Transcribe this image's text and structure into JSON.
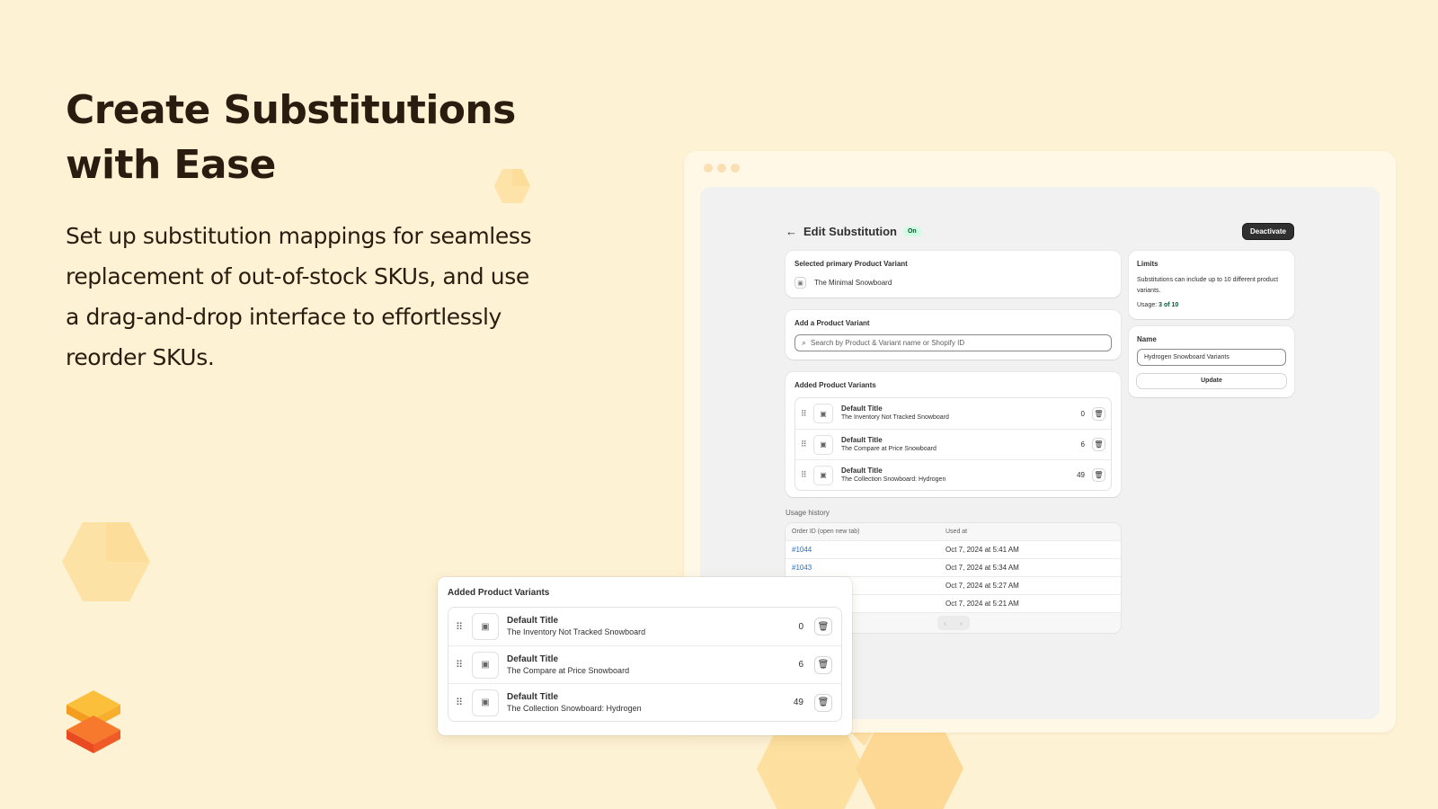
{
  "hero": {
    "title_line1": "Create Substitutions",
    "title_line2": "with Ease",
    "subtitle": "Set up substitution mappings for seamless replacement of out-of-stock SKUs, and use a drag-and-drop interface to effortlessly reorder SKUs."
  },
  "colors": {
    "background": "#fef2d4",
    "hex": "#fde3a8",
    "logo_orange": "#f7a829",
    "logo_red": "#ef4b23"
  },
  "app": {
    "back_icon": "arrow-left-icon",
    "title": "Edit Substitution",
    "status_badge": "On",
    "deactivate_label": "Deactivate",
    "primary_card": {
      "title": "Selected primary Product Variant",
      "variant_name": "The Minimal Snowboard"
    },
    "add_card": {
      "title": "Add a Product Variant",
      "search_placeholder": "Search by Product & Variant name or Shopify ID"
    },
    "variants_card": {
      "title": "Added Product Variants",
      "items": [
        {
          "title": "Default Title",
          "product": "The Inventory Not Tracked Snowboard",
          "qty": "0"
        },
        {
          "title": "Default Title",
          "product": "The Compare at Price Snowboard",
          "qty": "6"
        },
        {
          "title": "Default Title",
          "product": "The Collection Snowboard: Hydrogen",
          "qty": "49"
        }
      ]
    },
    "usage_history": {
      "label": "Usage history",
      "col_order": "Order ID (open new tab)",
      "col_used": "Used at",
      "rows": [
        {
          "order": "#1044",
          "used_at": "Oct 7, 2024 at 5:41 AM"
        },
        {
          "order": "#1043",
          "used_at": "Oct 7, 2024 at 5:34 AM"
        },
        {
          "order": "",
          "used_at": "Oct 7, 2024 at 5:27 AM"
        },
        {
          "order": "",
          "used_at": "Oct 7, 2024 at 5:21 AM"
        }
      ],
      "prev": "‹",
      "next": "›"
    },
    "limits": {
      "title": "Limits",
      "description": "Substitutions can include up to 10 different product variants.",
      "usage_label": "Usage:",
      "usage_value": "3 of 10"
    },
    "name_card": {
      "title": "Name",
      "value": "Hydrogen Snowboard Variants",
      "update_label": "Update"
    }
  },
  "zoom": {
    "title": "Added Product Variants",
    "items": [
      {
        "title": "Default Title",
        "product": "The Inventory Not Tracked Snowboard",
        "qty": "0"
      },
      {
        "title": "Default Title",
        "product": "The Compare at Price Snowboard",
        "qty": "6"
      },
      {
        "title": "Default Title",
        "product": "The Collection Snowboard: Hydrogen",
        "qty": "49"
      }
    ]
  }
}
